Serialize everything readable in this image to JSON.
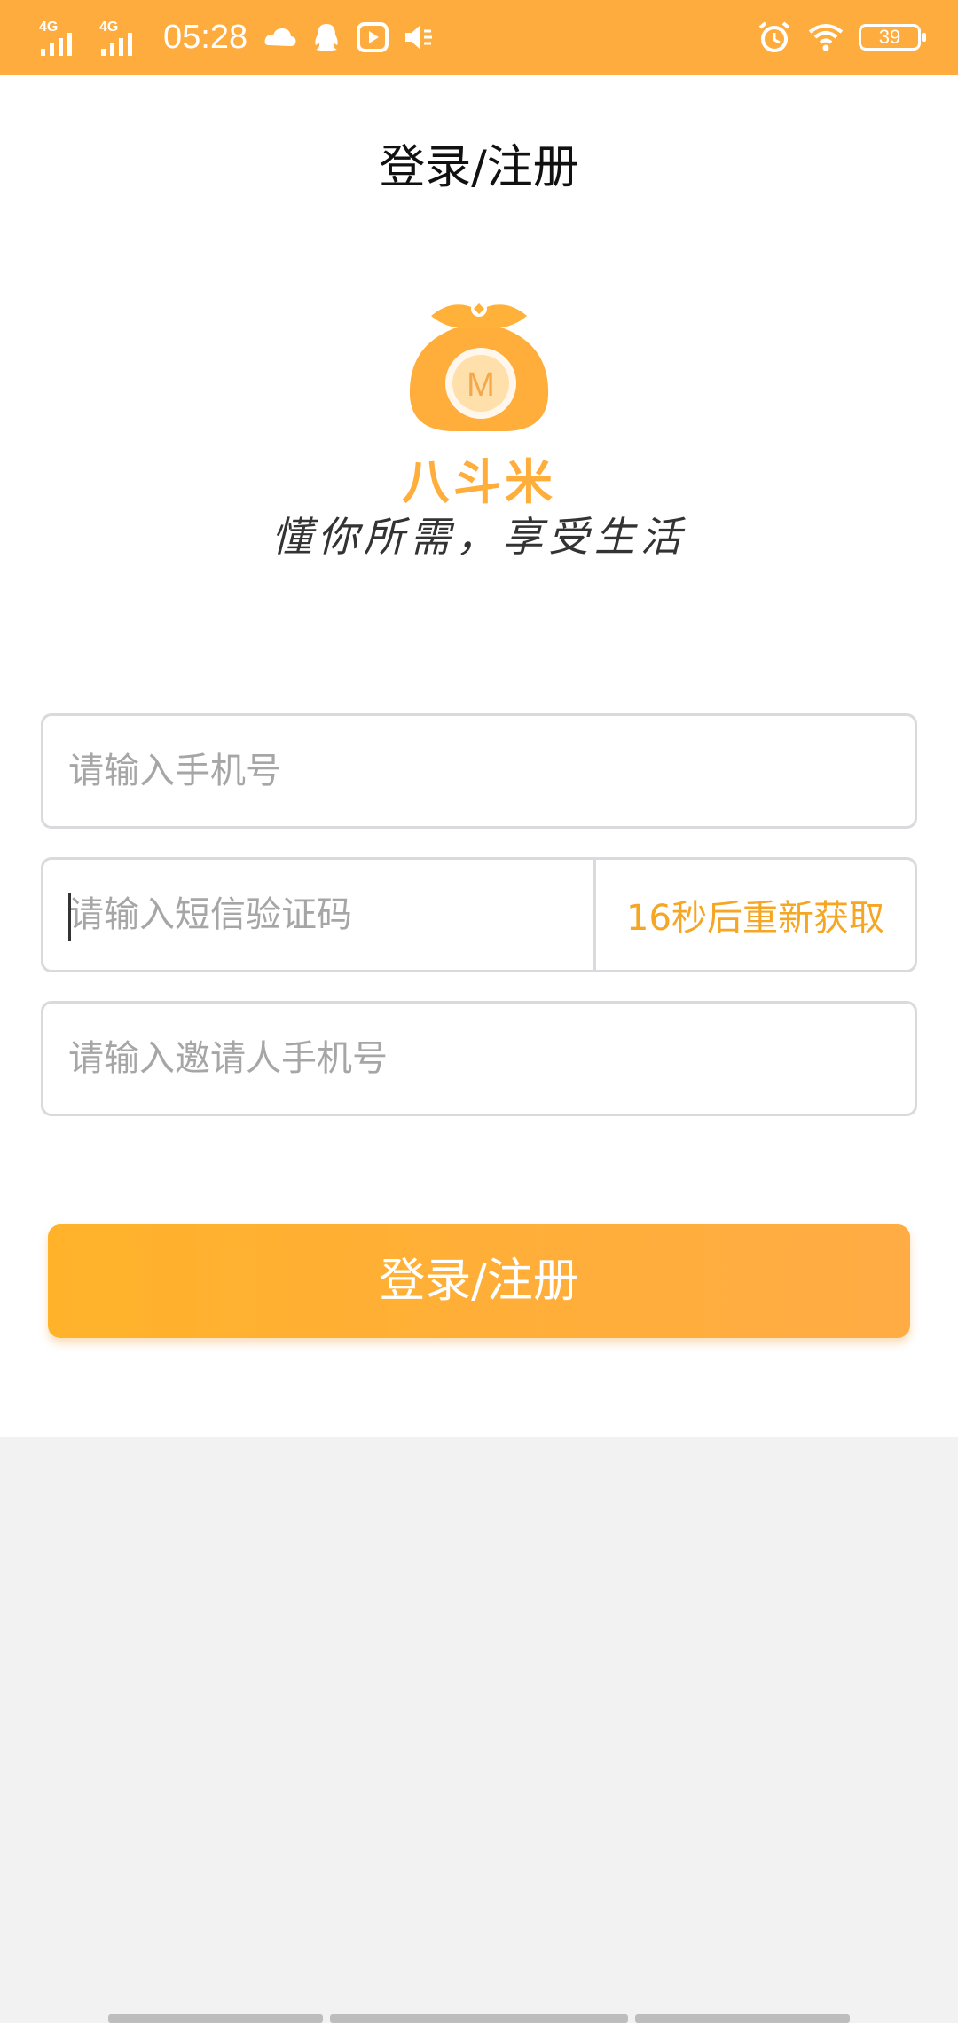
{
  "status_bar": {
    "network1": "4G",
    "network2": "4G",
    "time": "05:28",
    "battery": "39",
    "icons": [
      "signal-icon",
      "signal-icon",
      "cloud-icon",
      "qq-icon",
      "media-icon",
      "mute-icon",
      "alarm-icon",
      "wifi-icon",
      "battery-icon"
    ]
  },
  "header": {
    "title": "登录/注册"
  },
  "brand": {
    "name": "八斗米",
    "slogan": "懂你所需，享受生活",
    "colors": {
      "primary": "#ffad3b",
      "light": "#ffcf8a"
    }
  },
  "form": {
    "phone_placeholder": "请输入手机号",
    "code_placeholder": "请输入短信验证码",
    "code_button": "16秒后重新获取",
    "invite_placeholder": "请输入邀请人手机号",
    "submit_label": "登录/注册"
  },
  "colors": {
    "accent": "#ffac3f",
    "text_accent": "#f5a623",
    "border": "#d9d9de"
  }
}
